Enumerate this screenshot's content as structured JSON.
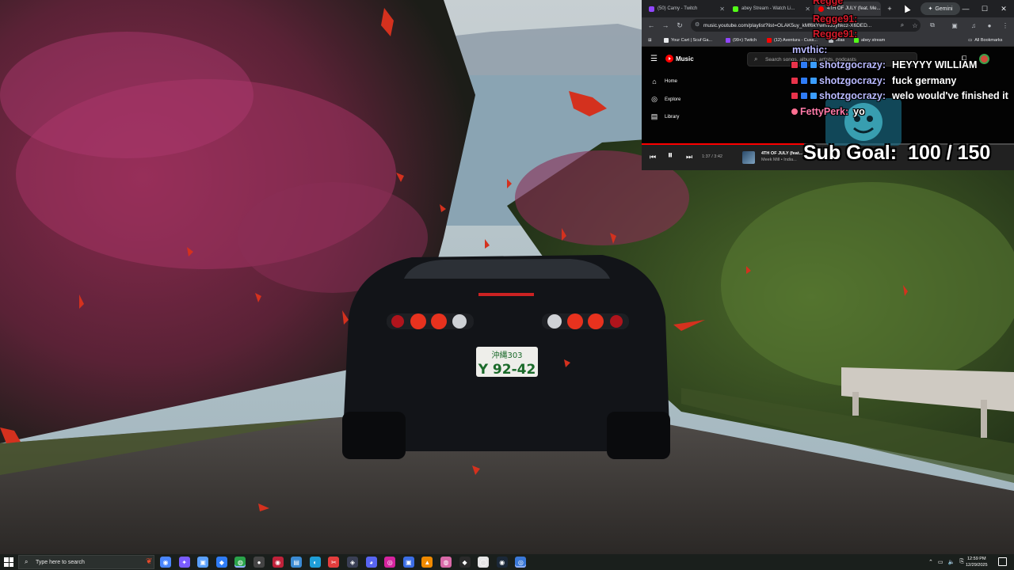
{
  "browser": {
    "tabs": [
      {
        "title": "(50) Camy - Twitch",
        "icon": "twitch-icon",
        "color": "#9146ff",
        "active": false
      },
      {
        "title": "abey Stream - Watch Li...",
        "icon": "kick-icon",
        "color": "#53fc18",
        "active": false
      },
      {
        "title": "4TH OF JULY (feat. Me...",
        "icon": "youtube-music-icon",
        "color": "#ff0000",
        "active": true
      }
    ],
    "gemini_label": "Gemini",
    "url": "music.youtube.com/playlist?list=OLAK5uy_kMf6kYwmvJ5yhkcz-X6DED...",
    "bookmarks": [
      {
        "label": "Your Cart | Scuf Ga...",
        "color": "#e8eaed"
      },
      {
        "label": "(99+) Twitch",
        "color": "#9146ff"
      },
      {
        "label": "(12) Aventura - Cuss...",
        "color": "#ff0000"
      },
      {
        "label": "ellas",
        "color": "#bdc1c6"
      },
      {
        "label": "abey stream",
        "color": "#53fc18"
      }
    ],
    "all_bookmarks_label": "All Bookmarks"
  },
  "ytmusic": {
    "logo_text": "Music",
    "nav": [
      {
        "label": "Home",
        "icon": "home-icon"
      },
      {
        "label": "Explore",
        "icon": "compass-icon"
      },
      {
        "label": "Library",
        "icon": "library-icon"
      }
    ],
    "search_placeholder": "Search songs, albums, artists, podcasts",
    "player": {
      "time": "1:37 / 3:42",
      "progress": 0.437,
      "title": "4TH OF JULY (feat...",
      "artist": "Meek Mill • India..."
    }
  },
  "chat": {
    "top_names": [
      "Regge",
      "Regge91:",
      "Regge91:"
    ],
    "partial_user": "mvthic:",
    "messages": [
      {
        "user": "shotzgocrazy:",
        "text": "HEYYYY WILLIAM"
      },
      {
        "user": "shotzgocrazy:",
        "text": "fuck germany"
      },
      {
        "user": "shotzgocrazy:",
        "text": "welo would've finished it"
      },
      {
        "user": "FettyPerk:",
        "text": "yo"
      }
    ]
  },
  "sub_goal": {
    "label": "Sub Goal:",
    "current": 100,
    "target": 150,
    "count_text": "100 / 150"
  },
  "taskbar": {
    "search_placeholder": "Type here to search",
    "apps": [
      {
        "icon": "cortana-icon",
        "color": "#4a86ff"
      },
      {
        "icon": "copilot-icon",
        "color": "#7a5cff"
      },
      {
        "icon": "task-view-icon",
        "color": "#5aa0ff"
      },
      {
        "icon": "app-blue-icon",
        "color": "#2f7cf6"
      },
      {
        "icon": "chrome-icon",
        "color": "#2aa34a"
      },
      {
        "icon": "obs-icon",
        "color": "#444444"
      },
      {
        "icon": "red-app-icon",
        "color": "#c0223a"
      },
      {
        "icon": "file-explorer-icon",
        "color": "#3b8bd4"
      },
      {
        "icon": "edge-icon",
        "color": "#1f9fd8"
      },
      {
        "icon": "capcut-icon",
        "color": "#e43d3d"
      },
      {
        "icon": "app-dark-icon",
        "color": "#3a3f55"
      },
      {
        "icon": "discord-icon",
        "color": "#5865f2"
      },
      {
        "icon": "instagram-icon",
        "color": "#d6249f"
      },
      {
        "icon": "app-blue2-icon",
        "color": "#3c6ee6"
      },
      {
        "icon": "vlc-icon",
        "color": "#f08a00"
      },
      {
        "icon": "app-pink-icon",
        "color": "#d96aa8"
      },
      {
        "icon": "epic-games-icon",
        "color": "#2a2a2a"
      },
      {
        "icon": "app-white-icon",
        "color": "#e6e6e6"
      },
      {
        "icon": "steam-icon",
        "color": "#1b2838"
      },
      {
        "icon": "chrome-active-icon",
        "color": "#3a78d8"
      }
    ],
    "time": "12:59 PM",
    "date": "12/29/2025"
  }
}
